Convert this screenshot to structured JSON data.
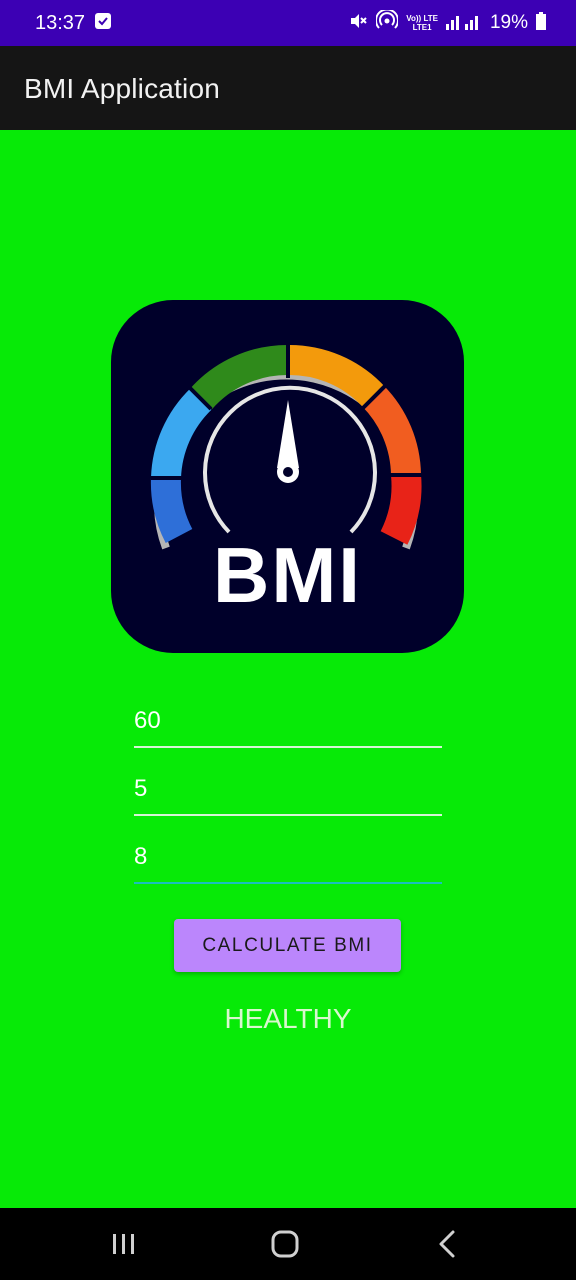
{
  "status_bar": {
    "time": "13:37",
    "volte_top": "Vo)) LTE",
    "volte_bottom": "LTE1",
    "battery_percent": "19%",
    "background": "#3C00B4"
  },
  "app_bar": {
    "title": "BMI Application",
    "background": "#151515"
  },
  "logo": {
    "text": "BMI"
  },
  "inputs": {
    "weight_value": "60",
    "height_feet_value": "5",
    "height_inches_value": "8"
  },
  "button": {
    "label": "CALCULATE BMI",
    "color": "#BB86FC"
  },
  "result": {
    "text": "HEALTHY"
  },
  "background_color": "#07EA07",
  "nav_bar": {
    "icons": [
      "recent-apps-icon",
      "home-icon",
      "back-icon"
    ]
  }
}
